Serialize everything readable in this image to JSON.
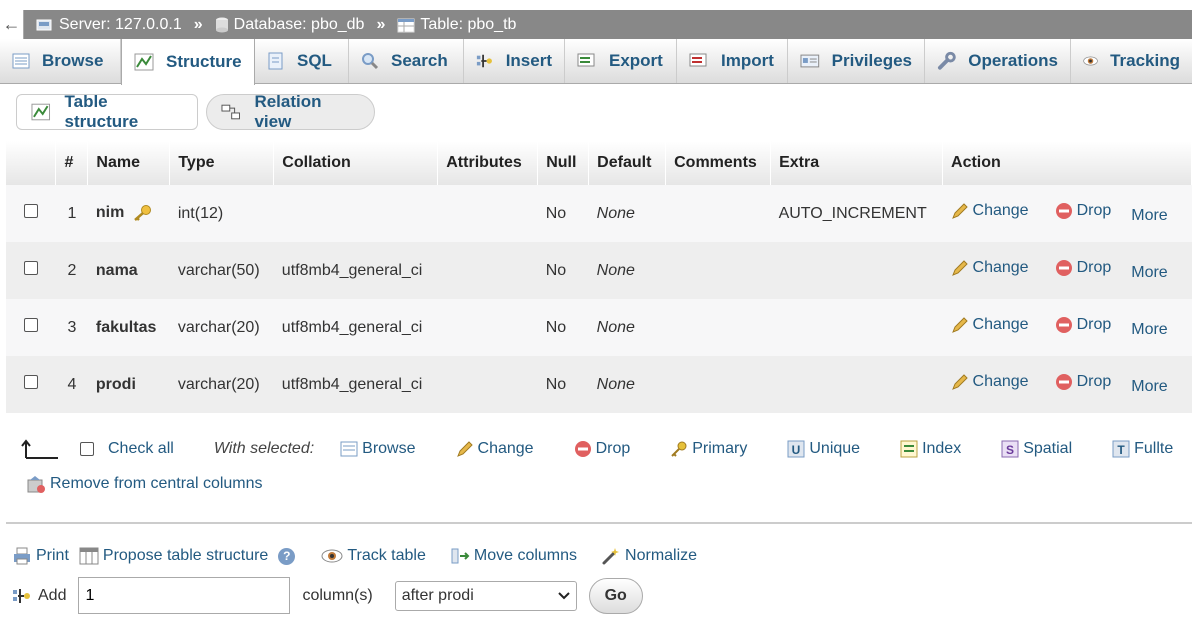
{
  "breadcrumb": {
    "back": "←",
    "server": "Server: 127.0.0.1",
    "database": "Database: pbo_db",
    "table": "Table: pbo_tb",
    "separator": "»"
  },
  "tabs": [
    {
      "label": "Browse",
      "icon": "browse-icon"
    },
    {
      "label": "Structure",
      "icon": "structure-icon",
      "active": true
    },
    {
      "label": "SQL",
      "icon": "sql-icon"
    },
    {
      "label": "Search",
      "icon": "search-icon"
    },
    {
      "label": "Insert",
      "icon": "insert-icon"
    },
    {
      "label": "Export",
      "icon": "export-icon"
    },
    {
      "label": "Import",
      "icon": "import-icon"
    },
    {
      "label": "Privileges",
      "icon": "privileges-icon"
    },
    {
      "label": "Operations",
      "icon": "wrench-icon"
    },
    {
      "label": "Tracking",
      "icon": "eye-icon"
    }
  ],
  "subtabs": {
    "table_structure": "Table structure",
    "relation_view": "Relation view"
  },
  "columns": {
    "hash": "#",
    "name": "Name",
    "type": "Type",
    "collation": "Collation",
    "attributes": "Attributes",
    "null": "Null",
    "default": "Default",
    "comments": "Comments",
    "extra": "Extra",
    "action": "Action"
  },
  "rows": [
    {
      "num": "1",
      "name": "nim",
      "key": true,
      "type": "int(12)",
      "collation": "",
      "null": "No",
      "default": "None",
      "extra": "AUTO_INCREMENT"
    },
    {
      "num": "2",
      "name": "nama",
      "key": false,
      "type": "varchar(50)",
      "collation": "utf8mb4_general_ci",
      "null": "No",
      "default": "None",
      "extra": ""
    },
    {
      "num": "3",
      "name": "fakultas",
      "key": false,
      "type": "varchar(20)",
      "collation": "utf8mb4_general_ci",
      "null": "No",
      "default": "None",
      "extra": ""
    },
    {
      "num": "4",
      "name": "prodi",
      "key": false,
      "type": "varchar(20)",
      "collation": "utf8mb4_general_ci",
      "null": "No",
      "default": "None",
      "extra": ""
    }
  ],
  "row_actions": {
    "change": "Change",
    "drop": "Drop",
    "more": "More"
  },
  "with_selected": {
    "check_all": "Check all",
    "label": "With selected:",
    "browse": "Browse",
    "change": "Change",
    "drop": "Drop",
    "primary": "Primary",
    "unique": "Unique",
    "index": "Index",
    "spatial": "Spatial",
    "fulltext": "Fullte"
  },
  "remove_central": "Remove from central columns",
  "tools": {
    "print": "Print",
    "propose": "Propose table structure",
    "help": "?",
    "track": "Track table",
    "move": "Move columns",
    "normalize": "Normalize"
  },
  "add_column": {
    "label": "Add",
    "value": "1",
    "unit": "column(s)",
    "position": "after prodi",
    "go": "Go"
  }
}
